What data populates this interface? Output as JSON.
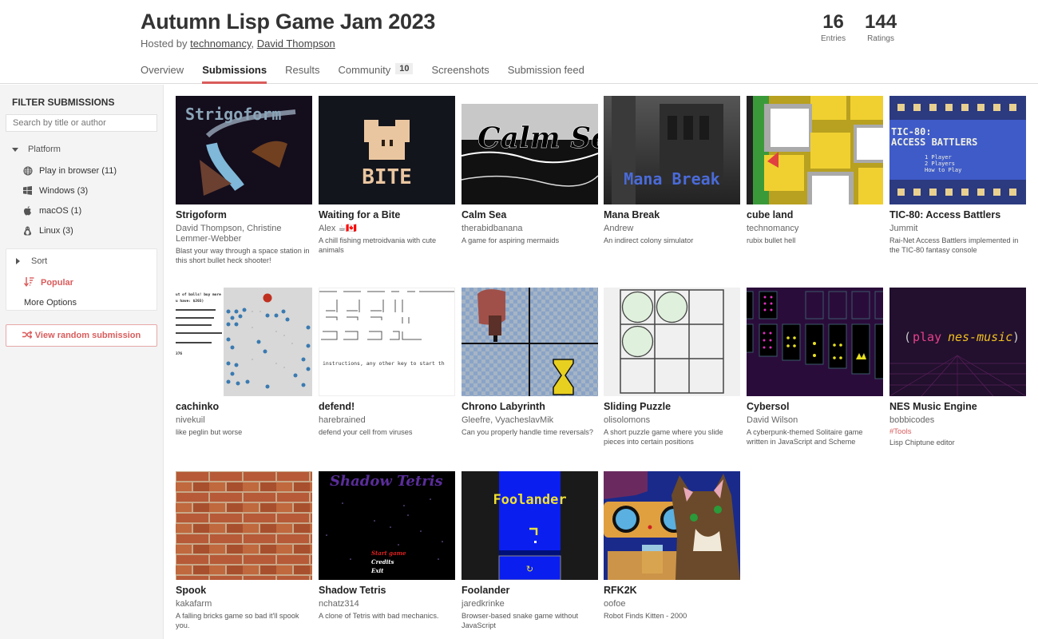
{
  "header": {
    "title": "Autumn Lisp Game Jam 2023",
    "hosted_prefix": "Hosted by ",
    "hosts": [
      "technomancy",
      "David Thompson"
    ],
    "host_separator": ", ",
    "stats": [
      {
        "value": "16",
        "label": "Entries"
      },
      {
        "value": "144",
        "label": "Ratings"
      }
    ],
    "tabs": [
      {
        "label": "Overview",
        "active": false
      },
      {
        "label": "Submissions",
        "active": true
      },
      {
        "label": "Results",
        "active": false
      },
      {
        "label": "Community",
        "active": false,
        "count": "10"
      },
      {
        "label": "Screenshots",
        "active": false
      },
      {
        "label": "Submission feed",
        "active": false
      }
    ]
  },
  "sidebar": {
    "title": "FILTER SUBMISSIONS",
    "search_placeholder": "Search by title or author",
    "platform_label": "Platform",
    "platforms": [
      {
        "label": "Play in browser (11)",
        "icon": "globe-icon"
      },
      {
        "label": "Windows (3)",
        "icon": "windows-icon"
      },
      {
        "label": "macOS (1)",
        "icon": "apple-icon"
      },
      {
        "label": "Linux (3)",
        "icon": "tux-icon"
      }
    ],
    "sort_label": "Sort",
    "sort_selected": "Popular",
    "more_options": "More Options",
    "random_button": "View random submission"
  },
  "submissions": [
    {
      "title": "Strigoform",
      "author": "David Thompson, Christine Lemmer-Webber",
      "description": "Blast your way through a space station in this short bullet heck shooter!",
      "thumb_text": "Strigoform"
    },
    {
      "title": "Waiting for a Bite",
      "author": "Alex ☕🇨🇦",
      "description": "A chill fishing metroidvania with cute animals",
      "thumb_text": "BITE"
    },
    {
      "title": "Calm Sea",
      "author": "therabidbanana",
      "description": "A game for aspiring mermaids",
      "thumb_text": "Calm Sea"
    },
    {
      "title": "Mana Break",
      "author": "Andrew",
      "description": "An indirect colony simulator",
      "thumb_text": "Mana Break"
    },
    {
      "title": "cube land",
      "author": "technomancy",
      "description": "rubix bullet hell"
    },
    {
      "title": "TIC-80: Access Battlers",
      "author": "Jummit",
      "description": "Rai-Net Access Battlers implemented in the TIC-80 fantasy console",
      "thumb_lines": [
        "TIC-80:",
        "ACCESS BATTLERS",
        "1 Player",
        "2 Players",
        "How to Play"
      ]
    },
    {
      "title": "cachinko",
      "author": "nivekuil",
      "description": "like peglin but worse",
      "thumb_lines": [
        "ut of balls! buy more",
        "u have: $203)",
        "376"
      ]
    },
    {
      "title": "defend!",
      "author": "harebrained",
      "description": "defend your cell from viruses",
      "thumb_text": "instructions, any other key to start th"
    },
    {
      "title": "Chrono Labyrinth",
      "author": "Gleefre, VyacheslavMik",
      "description": "Can you properly handle time reversals?"
    },
    {
      "title": "Sliding Puzzle",
      "author": "olisolomons",
      "description": "A short puzzle game where you slide pieces into certain positions"
    },
    {
      "title": "Cybersol",
      "author": "David Wilson",
      "description": "A cyberpunk-themed Solitaire game written in JavaScript and Scheme"
    },
    {
      "title": "NES Music Engine",
      "author": "bobbicodes",
      "tag": "#Tools",
      "description": "Lisp Chiptune editor",
      "thumb_lines": [
        "(",
        "play",
        "nes-music",
        ")"
      ]
    },
    {
      "title": "Spook",
      "author": "kakafarm",
      "description": "A falling bricks game so bad it'll spook you."
    },
    {
      "title": "Shadow Tetris",
      "author": "nchatz314",
      "description": "A clone of Tetris with bad mechanics.",
      "thumb_lines": [
        "Shadow Tetris",
        "Start game",
        "Credits",
        "Exit"
      ]
    },
    {
      "title": "Foolander",
      "author": "jaredkrinke",
      "description": "Browser-based snake game without JavaScript",
      "thumb_lines": [
        "Foolander",
        "↻"
      ]
    },
    {
      "title": "RFK2K",
      "author": "oofoe",
      "description": "Robot Finds Kitten - 2000"
    }
  ]
}
